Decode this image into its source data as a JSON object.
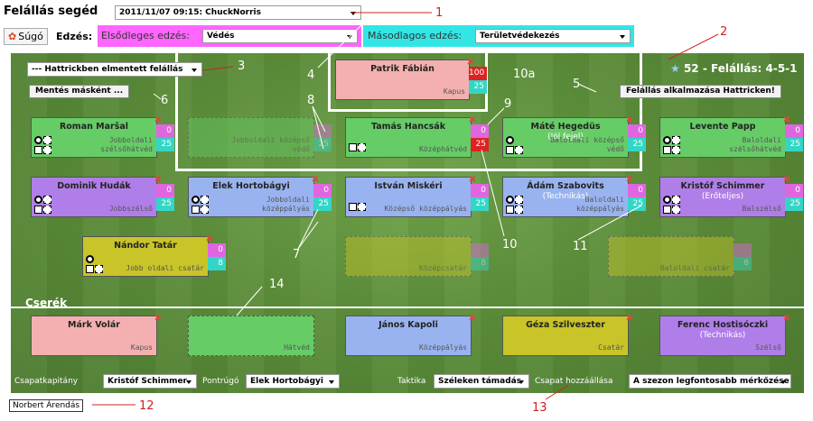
{
  "header": {
    "title": "Felállás segéd",
    "lineup_select": "2011/11/07 09:15: ChuckNorris",
    "help_label": "Súgó",
    "training_label": "Edzés:",
    "primary_label": "Elsődleges edzés:",
    "primary_value": "Védés",
    "secondary_label": "Másodlagos edzés:",
    "secondary_value": "Területvédekezés"
  },
  "pitch": {
    "saved_lineups": "--- Hattrickben elmentett felállás",
    "save_as": "Mentés másként ...",
    "apply": "Felállás alkalmazása Hattricken!",
    "formation": "52 - Felállás: 4-5-1",
    "substitutes_label": "Cserék"
  },
  "players": {
    "gk": {
      "name": "Patrik Fábián",
      "pos": "Kapus",
      "b1": "100",
      "b2": "25"
    },
    "rb": {
      "name": "Roman Maršal",
      "pos1": "Jobboldali",
      "pos2": "szélsőhátvéd",
      "b1": "0",
      "b2": "25"
    },
    "rcb_ghost": {
      "pos1": "Jobboldali középső",
      "pos2": "védő",
      "b2": "25"
    },
    "cb": {
      "name": "Tamás Hancsák",
      "pos": "Középhátvéd",
      "b1": "0",
      "b2": "25"
    },
    "lcb": {
      "name": "Máté Hegedüs",
      "sub": "(Jól fejel)",
      "pos1": "Baloldali középső",
      "pos2": "védő",
      "b1": "0",
      "b2": "25"
    },
    "lb": {
      "name": "Levente Papp",
      "pos1": "Baloldali",
      "pos2": "szélsőhátvéd",
      "b1": "0",
      "b2": "25"
    },
    "rw": {
      "name": "Dominik Hudák",
      "pos": "Jobbszélső",
      "b1": "0",
      "b2": "25"
    },
    "rim": {
      "name": "Elek Hortobágyi",
      "pos1": "Jobboldali",
      "pos2": "középpályás",
      "b1": "0",
      "b2": "25"
    },
    "im": {
      "name": "István Miskéri",
      "pos": "Középső középpályás",
      "b1": "0",
      "b2": "25"
    },
    "lim": {
      "name": "Ádám Szabovits",
      "sub": "(Technikás)",
      "pos1": "Baloldali",
      "pos2": "középpályás",
      "b1": "0",
      "b2": "25"
    },
    "lw": {
      "name": "Kristóf Schimmer",
      "sub": "(Erőteljes)",
      "pos": "Balszélső",
      "b1": "0",
      "b2": "25"
    },
    "rf": {
      "name": "Nándor Tatár",
      "pos": "Jobb oldali csatár",
      "b1": "0",
      "b2": "8"
    },
    "cf_ghost": {
      "pos": "Középcsatár",
      "b2": "8"
    },
    "lf_ghost": {
      "pos": "Baloldali csatár",
      "b2": "8"
    }
  },
  "subs": [
    {
      "name": "Márk Volár",
      "sub": "",
      "pos": "Kapus"
    },
    {
      "name": "",
      "sub": "",
      "pos": "Hátvéd"
    },
    {
      "name": "János Kapoli",
      "sub": "",
      "pos": "Középpályás"
    },
    {
      "name": "Géza Szilveszter",
      "sub": "",
      "pos": "Csatár"
    },
    {
      "name": "Ferenc Hostisóczki",
      "sub": "(Technikás)",
      "pos": "Szélső"
    }
  ],
  "bottom": {
    "captain_label": "Csapatkapitány",
    "captain_value": "Kristóf Schimmer",
    "setpiece_label": "Pontrúgó",
    "setpiece_value": "Elek Hortobágyi",
    "tactic_label": "Taktika",
    "tactic_value": "Széleken támadás",
    "attitude_label": "Csapat hozzáállása",
    "attitude_value": "A szezon legfontosabb mérkőzése"
  },
  "footer_name": "Norbert Árendás",
  "annotations": {
    "a1": "1",
    "a2": "2",
    "a3": "3",
    "a4": "4",
    "a5": "5",
    "a6": "6",
    "a7": "7",
    "a8": "8",
    "a9": "9",
    "a10": "10",
    "a10a": "10a",
    "a11": "11",
    "a12": "12",
    "a13": "13",
    "a14": "14"
  },
  "colors": {
    "primary_training": "#ff66ff",
    "secondary_training": "#33e6e6",
    "annotation": "#d02020"
  }
}
